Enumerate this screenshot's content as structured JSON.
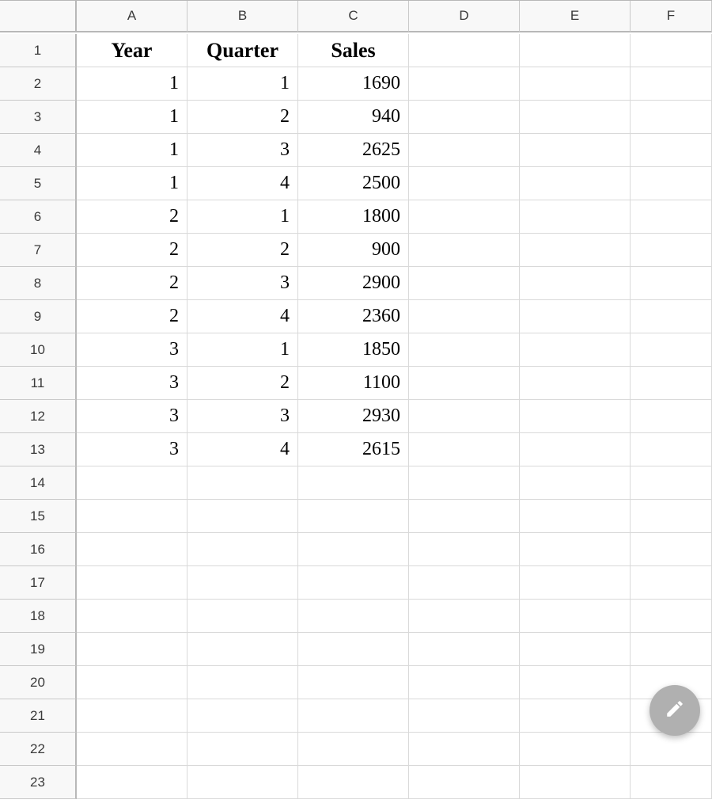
{
  "columns": [
    "A",
    "B",
    "C",
    "D",
    "E",
    "F"
  ],
  "visible_row_count": 23,
  "table": {
    "headers": [
      "Year",
      "Quarter",
      "Sales"
    ],
    "rows": [
      {
        "year": 1,
        "quarter": 1,
        "sales": 1690
      },
      {
        "year": 1,
        "quarter": 2,
        "sales": 940
      },
      {
        "year": 1,
        "quarter": 3,
        "sales": 2625
      },
      {
        "year": 1,
        "quarter": 4,
        "sales": 2500
      },
      {
        "year": 2,
        "quarter": 1,
        "sales": 1800
      },
      {
        "year": 2,
        "quarter": 2,
        "sales": 900
      },
      {
        "year": 2,
        "quarter": 3,
        "sales": 2900
      },
      {
        "year": 2,
        "quarter": 4,
        "sales": 2360
      },
      {
        "year": 3,
        "quarter": 1,
        "sales": 1850
      },
      {
        "year": 3,
        "quarter": 2,
        "sales": 1100
      },
      {
        "year": 3,
        "quarter": 3,
        "sales": 2930
      },
      {
        "year": 3,
        "quarter": 4,
        "sales": 2615
      }
    ]
  },
  "chart_data": {
    "type": "table",
    "title": "",
    "columns": [
      "Year",
      "Quarter",
      "Sales"
    ],
    "rows": [
      [
        1,
        1,
        1690
      ],
      [
        1,
        2,
        940
      ],
      [
        1,
        3,
        2625
      ],
      [
        1,
        4,
        2500
      ],
      [
        2,
        1,
        1800
      ],
      [
        2,
        2,
        900
      ],
      [
        2,
        3,
        2900
      ],
      [
        2,
        4,
        2360
      ],
      [
        3,
        1,
        1850
      ],
      [
        3,
        2,
        1100
      ],
      [
        3,
        3,
        2930
      ],
      [
        3,
        4,
        2615
      ]
    ]
  }
}
